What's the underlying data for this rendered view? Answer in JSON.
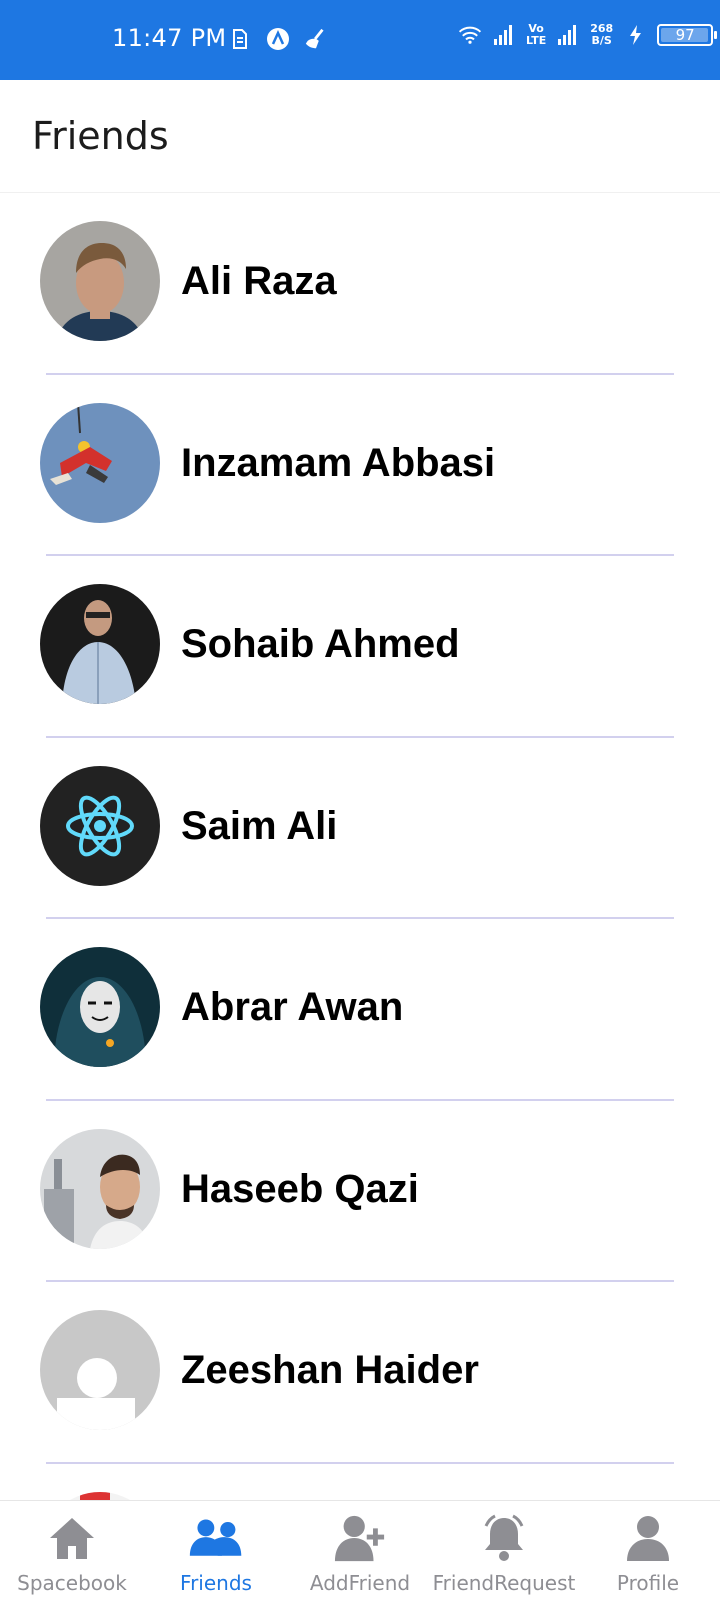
{
  "status_bar": {
    "time": "11:47 PM",
    "net_speed_value": "268",
    "net_speed_unit": "B/S",
    "network_label_top": "Vo",
    "network_label_bottom": "LTE",
    "battery_level": "97",
    "color": "#1e77e2"
  },
  "header": {
    "title": "Friends"
  },
  "friends": [
    {
      "name": "Ali Raza"
    },
    {
      "name": "Inzamam Abbasi"
    },
    {
      "name": "Sohaib Ahmed"
    },
    {
      "name": "Saim Ali"
    },
    {
      "name": "Abrar Awan"
    },
    {
      "name": "Haseeb Qazi"
    },
    {
      "name": "Zeeshan Haider"
    },
    {
      "name": ""
    }
  ],
  "tabs": [
    {
      "label": "Spacebook",
      "icon": "home-icon",
      "active": false
    },
    {
      "label": "Friends",
      "icon": "friends-icon",
      "active": true
    },
    {
      "label": "AddFriend",
      "icon": "add-friend-icon",
      "active": false
    },
    {
      "label": "FriendRequest",
      "icon": "bell-icon",
      "active": false
    },
    {
      "label": "Profile",
      "icon": "profile-icon",
      "active": false
    }
  ],
  "colors": {
    "active_tab": "#1e77e2",
    "inactive_tab": "#8e8e93",
    "divider": "#d2d0ee"
  }
}
